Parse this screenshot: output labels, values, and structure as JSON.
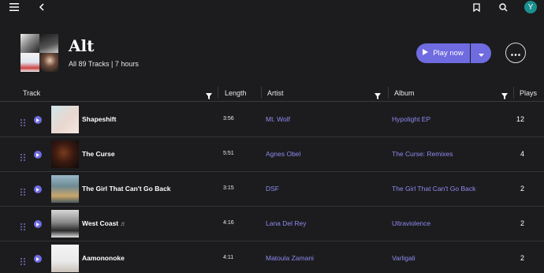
{
  "nav": {
    "menu_icon": "hamburger-icon",
    "back_icon": "chevron-left-icon",
    "bookmark_icon": "bookmark-icon",
    "search_icon": "search-icon",
    "avatar_initial": "Y"
  },
  "playlist": {
    "title": "Alt",
    "subtitle": "All 89 Tracks | 7 hours",
    "play_label": "Play now"
  },
  "columns": {
    "track": "Track",
    "length": "Length",
    "artist": "Artist",
    "album": "Album",
    "plays": "Plays"
  },
  "tracks": [
    {
      "title": "Shapeshift",
      "length": "3:56",
      "artist": "Mt. Wolf",
      "album": "Hypolight EP",
      "plays": "12"
    },
    {
      "title": "The Curse",
      "length": "5:51",
      "artist": "Agnes Obel",
      "album": "The Curse: Remixes",
      "plays": "4"
    },
    {
      "title": "The Girl That Can't Go Back",
      "length": "3:15",
      "artist": "DSF",
      "album": "The Girl That Can't Go Back",
      "plays": "2"
    },
    {
      "title": "West Coast",
      "length": "4:16",
      "artist": "Lana Del Rey",
      "album": "Ultraviolence",
      "plays": "2"
    },
    {
      "title": "Aamononoke",
      "length": "4:11",
      "artist": "Matoula Zamani",
      "album": "Varligali",
      "plays": "2"
    }
  ],
  "colors": {
    "accent": "#6f6be0",
    "link": "#8e8af0",
    "background": "#1c1c1e",
    "avatar": "#1a8f8f"
  }
}
